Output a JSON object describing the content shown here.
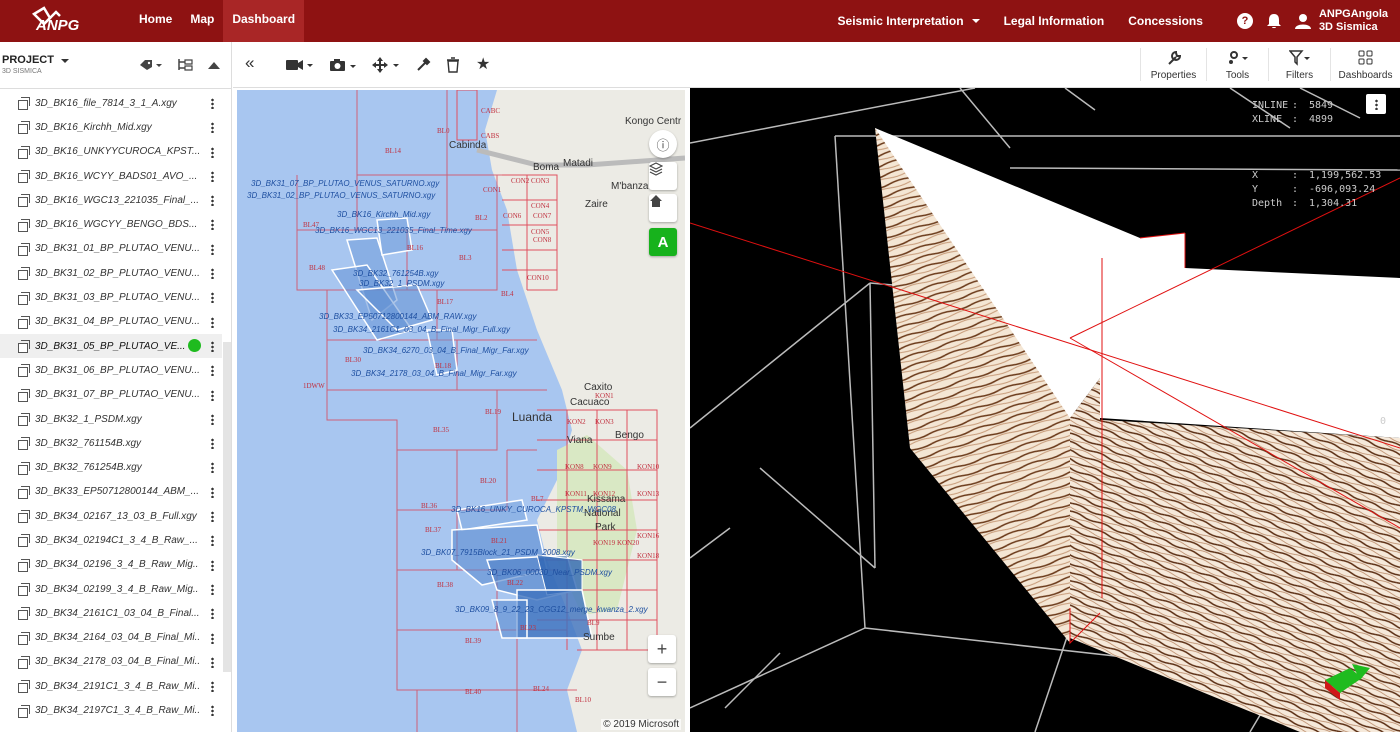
{
  "header": {
    "logo_text": "ANPG",
    "nav": [
      "Home",
      "Map",
      "Dashboard"
    ],
    "menu_seismic": "Seismic Interpretation",
    "menu_legal": "Legal Information",
    "menu_concessions": "Concessions",
    "user_name": "ANPGAngola",
    "user_sub": "3D Sismica",
    "brand_color": "#8e1212"
  },
  "project": {
    "title": "PROJECT",
    "subtitle": "3D SISMICA",
    "items": [
      "3D_BK16_file_7814_3_1_A.xgy",
      "3D_BK16_Kirchh_Mid.xgy",
      "3D_BK16_UNKYYCUROCA_KPST...",
      "3D_BK16_WCYY_BADS01_AVO_...",
      "3D_BK16_WGC13_221035_Final_...",
      "3D_BK16_WGCYY_BENGO_BDS...",
      "3D_BK31_01_BP_PLUTAO_VENU...",
      "3D_BK31_02_BP_PLUTAO_VENU...",
      "3D_BK31_03_BP_PLUTAO_VENU...",
      "3D_BK31_04_BP_PLUTAO_VENU...",
      "3D_BK31_05_BP_PLUTAO_VE...",
      "3D_BK31_06_BP_PLUTAO_VENU...",
      "3D_BK31_07_BP_PLUTAO_VENU...",
      "3D_BK32_1_PSDM.xgy",
      "3D_BK32_761154B.xgy",
      "3D_BK32_761254B.xgy",
      "3D_BK33_EP50712800144_ABM_...",
      "3D_BK34_02167_13_03_B_Full.xgy",
      "3D_BK34_02194C1_3_4_B_Raw_...",
      "3D_BK34_02196_3_4_B_Raw_Mig...",
      "3D_BK34_02199_3_4_B_Raw_Mig...",
      "3D_BK34_2161C1_03_04_B_Final...",
      "3D_BK34_2164_03_04_B_Final_Mi...",
      "3D_BK34_2178_03_04_B_Final_Mi...",
      "3D_BK34_2191C1_3_4_B_Raw_Mi...",
      "3D_BK34_2197C1_3_4_B_Raw_Mi..."
    ],
    "selected_index": 10
  },
  "toolbar": {
    "properties": "Properties",
    "tools": "Tools",
    "filters": "Filters",
    "dashboards": "Dashboards"
  },
  "map": {
    "copyright": "© 2019 Microsoft",
    "layer_button": "A",
    "zoom_in": "+",
    "zoom_out": "−",
    "places": [
      "Cabinda",
      "Boma",
      "Matadi",
      "Kongo Centr",
      "M'banza",
      "Zaire",
      "Caxito",
      "Cacuaco",
      "Luanda",
      "Viana",
      "Bengo",
      "Kissama",
      "National",
      "Park",
      "Sumbe"
    ],
    "blocks": [
      "BL0",
      "BL14",
      "BL2",
      "BL47",
      "BL3",
      "BL16",
      "BL48",
      "BL17",
      "BL4",
      "BL30",
      "BL18",
      "BL19",
      "BL35",
      "BL36",
      "BL20",
      "BL7",
      "BL37",
      "BL21",
      "BL38",
      "BL22",
      "BL23",
      "BL9",
      "BL39",
      "BL40",
      "BL24",
      "BL10",
      "CON1",
      "CON2",
      "CON3",
      "CON4",
      "CON5",
      "CON6",
      "CON7",
      "CON8",
      "CON10",
      "CABC",
      "CABS",
      "KON1",
      "KON2",
      "KON3",
      "KON8",
      "KON9",
      "KON10",
      "KON11",
      "KON12",
      "KON13",
      "KON16",
      "KON18",
      "KON19",
      "KON20",
      "1DWW"
    ],
    "survey_labels": [
      "3D_BK31_07_BP_PLUTAO_VENUS_SATURNO.xgy",
      "3D_BK31_02_BP_PLUTAO_VENUS_SATURNO.xgy",
      "3D_BK16_Kirchh_Mid.xgy",
      "3D_BK16_WGC13_221035_Final_Time.xgy",
      "3D_BK32_761254B.xgy",
      "3D_BK32_1_PSDM.xgy",
      "3D_BK33_EP50712800144_ABM_RAW.xgy",
      "3D_BK34_2161C1_03_04_B_Final_Migr_Full.xgy",
      "3D_BK34_6270_03_04_B_Final_Migr_Far.xgy",
      "3D_BK34_2178_03_04_B_Final_Migr_Far.xgy",
      "3D_BK16_UNKY_CUROCA_KPSTM_WGC08",
      "3D_BK07_7915Block_21_PSDM_2008.xgy",
      "3D_BK06_00030_Near_PSDM.xgy",
      "3D_BK09_8_9_22_23_CGG12_merge_kwanza_2.xgy"
    ]
  },
  "viewer": {
    "inline_label": "INLINE",
    "inline_value": "5849",
    "xline_label": "XLINE",
    "xline_value": "4899",
    "x_label": "X",
    "x_value": "1,199,562.53",
    "y_label": "Y",
    "y_value": "-696,093.24",
    "depth_label": "Depth",
    "depth_value": "1,304.31",
    "zero_tick": "0"
  }
}
